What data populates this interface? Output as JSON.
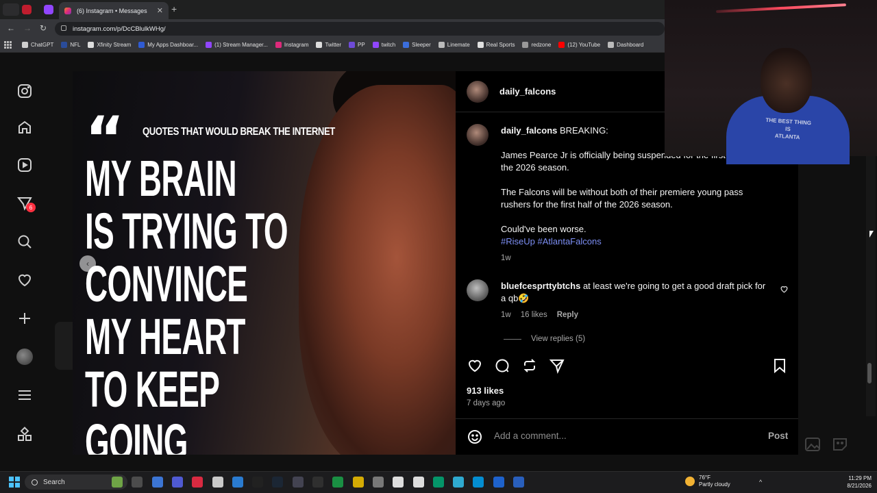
{
  "browser": {
    "active_tab_title": "(6) Instagram • Messages",
    "url": "instagram.com/p/DcCBlulkWHg/",
    "new_tab_symbol": "+",
    "close_symbol": "✕",
    "bookmarks": [
      {
        "label": "ChatGPT",
        "color": "#cfcfcf"
      },
      {
        "label": "NFL",
        "color": "#2a4c9a"
      },
      {
        "label": "Xfinity Stream",
        "color": "#dddddd"
      },
      {
        "label": "My Apps Dashboar...",
        "color": "#2f5bd3"
      },
      {
        "label": "(1) Stream Manager...",
        "color": "#9146ff"
      },
      {
        "label": "Instagram",
        "color": "#dd2a7b"
      },
      {
        "label": "Twitter",
        "color": "#dddddd"
      },
      {
        "label": "PP",
        "color": "#6e4bd8"
      },
      {
        "label": "twitch",
        "color": "#9146ff"
      },
      {
        "label": "Sleeper",
        "color": "#3b6edc"
      },
      {
        "label": "Linemate",
        "color": "#bbbbbb"
      },
      {
        "label": "Real Sports",
        "color": "#e0e0e0"
      },
      {
        "label": "redzone",
        "color": "#999999"
      },
      {
        "label": "(12) YouTube",
        "color": "#ff0000"
      },
      {
        "label": "Dashboard",
        "color": "#bbbbbb"
      }
    ]
  },
  "sidebar": {
    "notification_count": "6"
  },
  "post": {
    "image": {
      "quote_tag": "QUOTES THAT WOULD BREAK THE INTERNET",
      "quote_body": "MY BRAIN\nIS TRYING TO\nCONVINCE\nMY HEART\nTO KEEP\nGOING",
      "prev_arrow": "‹",
      "total_slides": 2,
      "current_slide": 2
    },
    "author": "daily_falcons",
    "caption": {
      "lead": "BREAKING:",
      "paragraph1": "James Pearce Jr is officially being suspended for the first 8 games of the 2026 season.",
      "paragraph2": "The Falcons will be without both of their premiere young pass rushers for the first half of the 2026 season.",
      "paragraph3": "Could've been worse.",
      "hashtags": "#RiseUp #AtlantaFalcons",
      "age": "1w"
    },
    "comment": {
      "user": "bluefcesprttybtchs",
      "text": "at least we're going to get a good draft pick for a qb🤣",
      "age": "1w",
      "likes": "16 likes",
      "reply_label": "Reply",
      "view_replies": "View replies (5)"
    },
    "likes": "913 likes",
    "posted_ago": "7 days ago",
    "comment_placeholder": "Add a comment...",
    "post_button": "Post"
  },
  "webcam": {
    "shirt_text": "THE BEST THING\nIS\nATLANTA"
  },
  "taskbar": {
    "search_label": "Search",
    "weather_temp": "76°F",
    "weather_desc": "Partly cloudy",
    "time": "11:29 PM",
    "date": "8/21/2026",
    "tray_caret": "^"
  },
  "colors": {
    "hashtag": "#7d8ff5",
    "notification_badge": "#ff3040",
    "instagram_bg": "#000000"
  }
}
